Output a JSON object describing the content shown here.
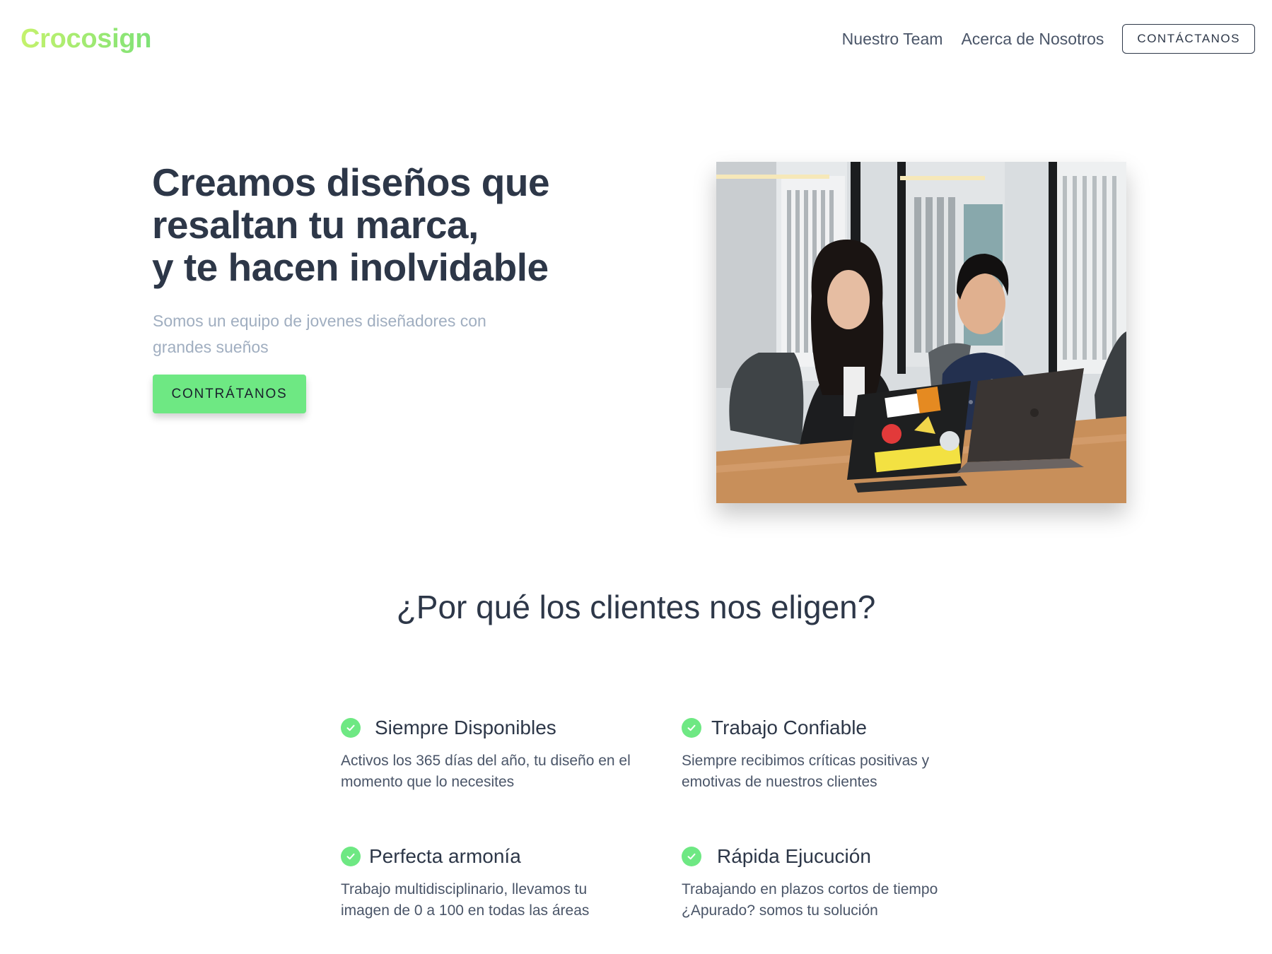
{
  "header": {
    "logo_text": "Crocosign",
    "nav": {
      "team_label": "Nuestro Team",
      "about_label": "Acerca de Nosotros",
      "contact_label": "CONTÁCTANOS"
    }
  },
  "hero": {
    "title_line1": "Creamos diseños que",
    "title_line2": "resaltan tu marca,",
    "title_line3": "y te hacen inolvidable",
    "subtitle": "Somos un equipo de jovenes diseñadores con grandes sueños",
    "cta_label": "CONTRÁTANOS",
    "image_alt": "Dos personas trabajando con laptops en una oficina"
  },
  "why": {
    "title": "¿Por qué los clientes nos eligen?",
    "features": [
      {
        "title": "Siempre Disponibles",
        "description": "Activos los 365 días del año, tu diseño en el momento que lo necesites"
      },
      {
        "title": "Trabajo Confiable",
        "description": "Siempre recibimos críticas positivas y emotivas de nuestros clientes"
      },
      {
        "title": "Perfecta armonía",
        "description": "Trabajo multidisciplinario, llevamos tu imagen de 0 a 100 en todas las áreas"
      },
      {
        "title": "Rápida Ejucución",
        "description": "Trabajando en plazos cortos de tiempo ¿Apurado? somos tu solución"
      }
    ]
  },
  "colors": {
    "accent_green": "#6ee883",
    "logo_gradient_start": "#c5f26c",
    "logo_gradient_end": "#7ee277",
    "heading_text": "#2d3748",
    "muted_text": "#a0aec0"
  },
  "icons": {
    "feature_icon": "check-circle-icon"
  }
}
